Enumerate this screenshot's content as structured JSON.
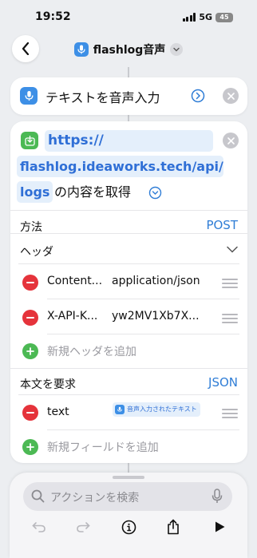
{
  "status": {
    "time": "19:52",
    "network": "5G",
    "battery": "45"
  },
  "nav": {
    "title": "flashlog音声"
  },
  "action1": {
    "title": "テキストを音声入力"
  },
  "action2": {
    "url_part1": "https://",
    "url_part2": "flashlog.ideaworks.tech/api/",
    "url_part3": "logs",
    "url_suffix": "の内容を取得",
    "method_label": "方法",
    "method_value": "POST",
    "headers_label": "ヘッダ",
    "headers": [
      {
        "key": "Content...",
        "value": "application/json"
      },
      {
        "key": "X-API-K...",
        "value": "yw2MV1Xb7X..."
      }
    ],
    "add_header_label": "新規ヘッダを追加",
    "body_label": "本文を要求",
    "body_type": "JSON",
    "fields": [
      {
        "key": "text",
        "token": "音声入力されたテキスト"
      }
    ],
    "add_field_label": "新規フィールドを追加"
  },
  "search": {
    "placeholder": "アクションを検索"
  },
  "colors": {
    "accent": "#2f7dd6",
    "green": "#4cb954",
    "red": "#e5333b"
  }
}
